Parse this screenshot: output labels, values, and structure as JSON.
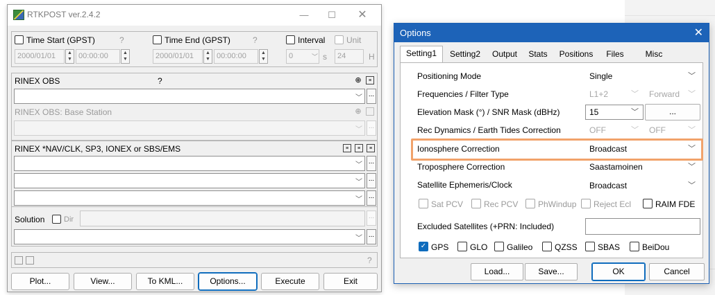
{
  "rtkpost": {
    "title": "RTKPOST ver.2.4.2",
    "time_start": {
      "label": "Time Start (GPST)",
      "help": "?",
      "date": "2000/01/01",
      "time": "00:00:00"
    },
    "time_end": {
      "label": "Time End (GPST)",
      "help": "?",
      "date": "2000/01/01",
      "time": "00:00:00"
    },
    "interval": {
      "label": "Interval",
      "value": "0",
      "unit_suffix": "s"
    },
    "unit": {
      "label": "Unit",
      "value": "24",
      "suffix": "H"
    },
    "rinex_obs": {
      "label": "RINEX OBS",
      "help": "?"
    },
    "rinex_obs_base": {
      "label": "RINEX OBS: Base Station"
    },
    "rinex_nav": {
      "label": "RINEX *NAV/CLK, SP3, IONEX or SBS/EMS"
    },
    "solution": {
      "label": "Solution",
      "dir_label": "Dir"
    },
    "status_help": "?",
    "buttons": {
      "plot": "Plot...",
      "view": "View...",
      "to_kml": "To KML...",
      "options": "Options...",
      "execute": "Execute",
      "exit": "Exit"
    },
    "ellipsis": "..."
  },
  "options": {
    "title": "Options",
    "tabs": [
      "Setting1",
      "Setting2",
      "Output",
      "Stats",
      "Positions",
      "Files",
      "Misc"
    ],
    "active_tab": "Setting1",
    "rows": {
      "positioning_mode": {
        "label": "Positioning Mode",
        "value": "Single"
      },
      "frequencies": {
        "label": "Frequencies / Filter Type",
        "value": "L1+2",
        "value2": "Forward"
      },
      "elevation": {
        "label": "Elevation Mask (°) / SNR Mask (dBHz)",
        "value": "15",
        "button": "..."
      },
      "rec_dynamics": {
        "label": "Rec Dynamics / Earth Tides Correction",
        "value": "OFF",
        "value2": "OFF"
      },
      "ionosphere": {
        "label": "Ionosphere Correction",
        "value": "Broadcast"
      },
      "troposphere": {
        "label": "Troposphere Correction",
        "value": "Saastamoinen"
      },
      "ephemeris": {
        "label": "Satellite Ephemeris/Clock",
        "value": "Broadcast"
      }
    },
    "checks": {
      "sat_pcv": "Sat PCV",
      "rec_pcv": "Rec PCV",
      "phwindup": "PhWindup",
      "reject_ecl": "Reject Ecl",
      "raim_fde": "RAIM FDE"
    },
    "excluded_sats": {
      "label": "Excluded Satellites (+PRN: Included)",
      "value": ""
    },
    "constellations": {
      "gps": "GPS",
      "glo": "GLO",
      "galileo": "Galileo",
      "qzss": "QZSS",
      "sbas": "SBAS",
      "beidou": "BeiDou"
    },
    "constellation_checked": {
      "gps": true
    },
    "buttons": {
      "load": "Load...",
      "save": "Save...",
      "ok": "OK",
      "cancel": "Cancel"
    },
    "highlight_color": "#f1a26a",
    "accent": "#1d63b8"
  }
}
